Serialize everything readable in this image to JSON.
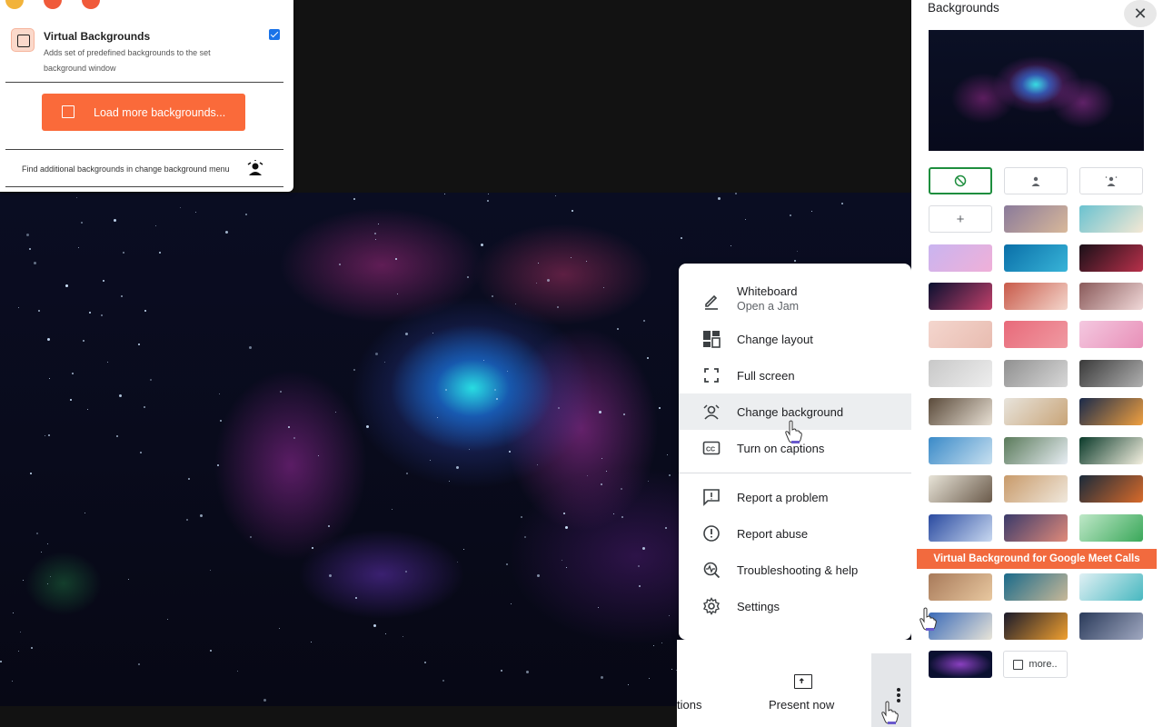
{
  "extension": {
    "item_title": "Virtual Backgrounds",
    "item_desc": "Adds set of predefined backgrounds to the set background window",
    "item_enabled": true,
    "load_button": "Load more backgrounds...",
    "footer_text": "Find additional backgrounds in change background menu",
    "accent": "#fa6a3a"
  },
  "menu": {
    "items": [
      {
        "label": "Whiteboard",
        "sublabel": "Open a Jam",
        "icon": "pencil-icon"
      },
      {
        "label": "Change layout",
        "icon": "layout-icon"
      },
      {
        "label": "Full screen",
        "icon": "fullscreen-icon"
      },
      {
        "label": "Change background",
        "icon": "background-icon",
        "highlighted": true
      },
      {
        "label": "Turn on captions",
        "icon": "captions-icon"
      },
      {
        "label": "Report a problem",
        "icon": "feedback-icon"
      },
      {
        "label": "Report abuse",
        "icon": "alert-icon"
      },
      {
        "label": "Troubleshooting & help",
        "icon": "troubleshoot-icon"
      },
      {
        "label": "Settings",
        "icon": "gear-icon"
      }
    ]
  },
  "bottom_bar": {
    "captions_label": "tions",
    "present_label": "Present now"
  },
  "panel": {
    "title": "Backgrounds",
    "promo_banner": "Virtual Background for Google Meet Calls",
    "more_label": "more..",
    "selected_option": "no-effect",
    "tiles": [
      [
        "#8a7a9a",
        "#d8b89a"
      ],
      [
        "#6ac2d0",
        "#f4e8d4"
      ],
      [
        "#c9b4f0",
        "#f0b0d8"
      ],
      [
        "#0a6fa8",
        "#38b4d8"
      ],
      [
        "#1a1018",
        "#b8304a"
      ],
      [
        "#0a1030",
        "#c0406a"
      ],
      [
        "#c85a4a",
        "#f4d6cc"
      ],
      [
        "#8a5a5a",
        "#f0d8d8"
      ],
      [
        "#f4d6ce",
        "#e8bcb0"
      ],
      [
        "#e86a7a",
        "#f09aa2"
      ],
      [
        "#f4c8e0",
        "#e890b8"
      ],
      [
        "#c8c8c8",
        "#eeeeee"
      ],
      [
        "#909090",
        "#d8d8d8"
      ],
      [
        "#3a3a3a",
        "#b0b0b0"
      ],
      [
        "#5a4a3a",
        "#e8e0d4"
      ],
      [
        "#e8e4dc",
        "#c8a478"
      ],
      [
        "#1a2a4a",
        "#f0a040"
      ],
      [
        "#3a8ac8",
        "#c8e0f0"
      ],
      [
        "#5a7a5a",
        "#e8eef4"
      ],
      [
        "#0a3a2a",
        "#f4f0e0"
      ],
      [
        "#e8e4d8",
        "#6a5a4a"
      ],
      [
        "#c89a6a",
        "#f0e8dc"
      ],
      [
        "#1a2a3a",
        "#d86a2a"
      ],
      [
        "#2a4aa0",
        "#c8d8f0"
      ],
      [
        "#3a3a6a",
        "#e08a7a"
      ],
      [
        "#bfe8c8",
        "#3aa85a"
      ],
      [
        "#a87a5a",
        "#e8c8a0"
      ],
      [
        "#1a6a8a",
        "#c8b898"
      ],
      [
        "#e0f0f4",
        "#48b8c0"
      ],
      [
        "#3a6ab8",
        "#e8e4d8"
      ],
      [
        "#1a1a2a",
        "#f0a030"
      ],
      [
        "#2a3a5a",
        "#a0a8c0"
      ],
      [
        "#0a1030",
        "#8a40c0"
      ]
    ]
  }
}
